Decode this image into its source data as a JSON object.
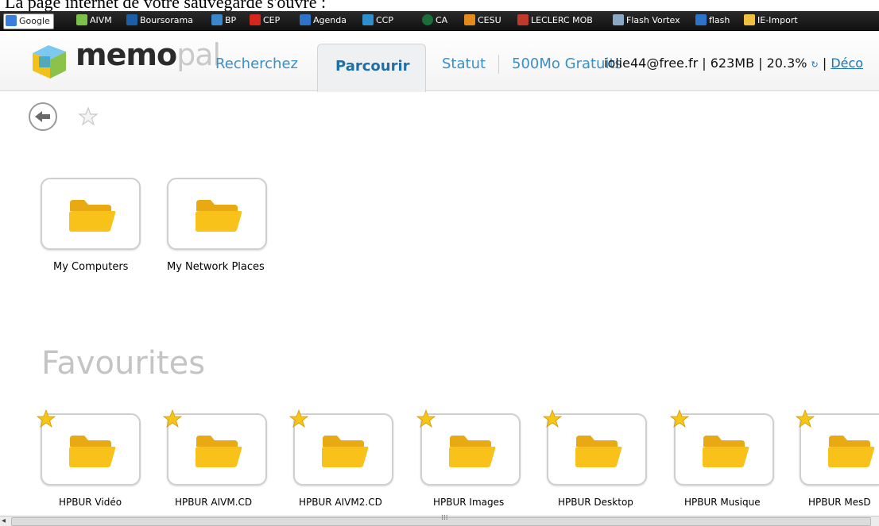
{
  "caption": "La page internet de votre sauvegarde s'ouvre :",
  "bookmarks": [
    {
      "label": "Google",
      "icon": "google-icon",
      "color": "#3b7ddd"
    },
    {
      "label": "AIVM",
      "icon": "aivm-icon",
      "color": "#7cc24a"
    },
    {
      "label": "Boursorama",
      "icon": "boursorama-icon",
      "color": "#1c5fa8"
    },
    {
      "label": "BP",
      "icon": "bp-icon",
      "color": "#3a88c9"
    },
    {
      "label": "CEP",
      "icon": "cep-icon",
      "color": "#d7261b"
    },
    {
      "label": "Agenda",
      "icon": "calendar-icon",
      "color": "#2b74c9"
    },
    {
      "label": "CCP",
      "icon": "ccp-icon",
      "color": "#2f8fcc"
    },
    {
      "label": "CA",
      "icon": "ca-icon",
      "color": "#1b6d3a"
    },
    {
      "label": "CESU",
      "icon": "cesu-icon",
      "color": "#e58a1c"
    },
    {
      "label": "LECLERC MOB",
      "icon": "leclerc-icon",
      "color": "#c0392b"
    },
    {
      "label": "Flash Vortex",
      "icon": "flash-vortex-icon",
      "color": "#8aa7c6"
    },
    {
      "label": "flash",
      "icon": "flash-icon",
      "color": "#2b74c9"
    },
    {
      "label": "IE-Import",
      "icon": "folder-icon",
      "color": "#f0c040"
    }
  ],
  "nav": {
    "logo_main": "memo",
    "logo_sub": "pal",
    "tab_search": "Recherchez",
    "tab_browse": "Parcourir",
    "tab_status": "Statut",
    "tab_free": "500Mo Gratuits",
    "user_line": "iolie44@free.fr | 623MB | 20.3%",
    "logout": "Déco"
  },
  "folders": [
    {
      "label": "My Computers"
    },
    {
      "label": "My Network Places"
    }
  ],
  "favourites_title": "Favourites",
  "favourites": [
    {
      "label": "HPBUR Vidéo"
    },
    {
      "label": "HPBUR AIVM.CD"
    },
    {
      "label": "HPBUR AIVM2.CD"
    },
    {
      "label": "HPBUR Images"
    },
    {
      "label": "HPBUR Desktop"
    },
    {
      "label": "HPBUR Musique"
    },
    {
      "label": "HPBUR MesD"
    }
  ],
  "colors": {
    "accent": "#3b8fc4",
    "folder": "#f9c21b",
    "star": "#f5c518"
  }
}
